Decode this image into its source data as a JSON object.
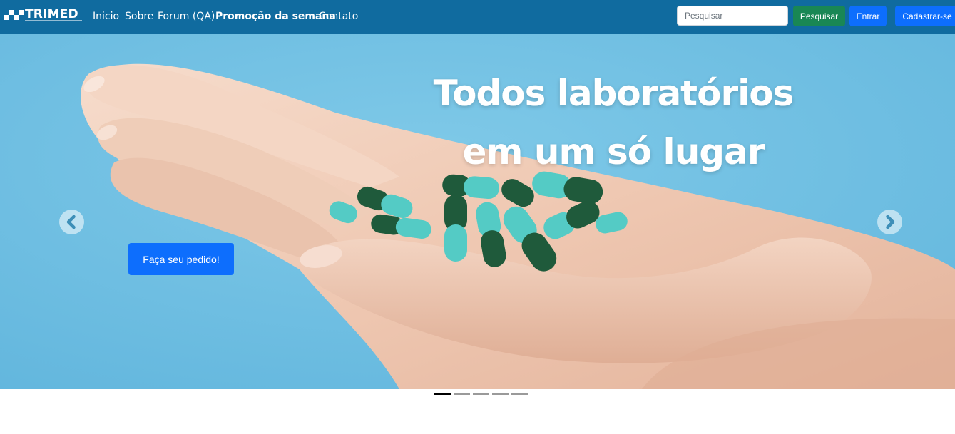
{
  "brand": {
    "name": "TRIMED",
    "tagline": "DISTRIBUIDORA DE MEDICAMENTOS"
  },
  "nav": {
    "items": [
      {
        "label": "Inicio",
        "bold": false
      },
      {
        "label": "Sobre",
        "bold": false
      },
      {
        "label": "Forum (QA)",
        "bold": false
      },
      {
        "label": "Promoção da semana",
        "bold": true
      },
      {
        "label": "Contato",
        "bold": false
      }
    ]
  },
  "search": {
    "placeholder": "Pesquisar",
    "value": "",
    "button_label": "Pesquisar"
  },
  "auth": {
    "login_label": "Entrar",
    "signup_label": "Cadastrar-se"
  },
  "carousel": {
    "headline_line1": "Todos laboratórios",
    "headline_line2": "em um só lugar",
    "cta_label": "Faça seu pedido!",
    "prev_icon": "chevron-left-icon",
    "next_icon": "chevron-right-icon",
    "slide_count": 5,
    "active_index": 0
  },
  "colors": {
    "navbar": "#106b9f",
    "primary": "#0d6efd",
    "success": "#198754",
    "sky": "#72c0e2",
    "capsule_dark": "#1f5a3b",
    "capsule_light": "#54cbc5"
  }
}
